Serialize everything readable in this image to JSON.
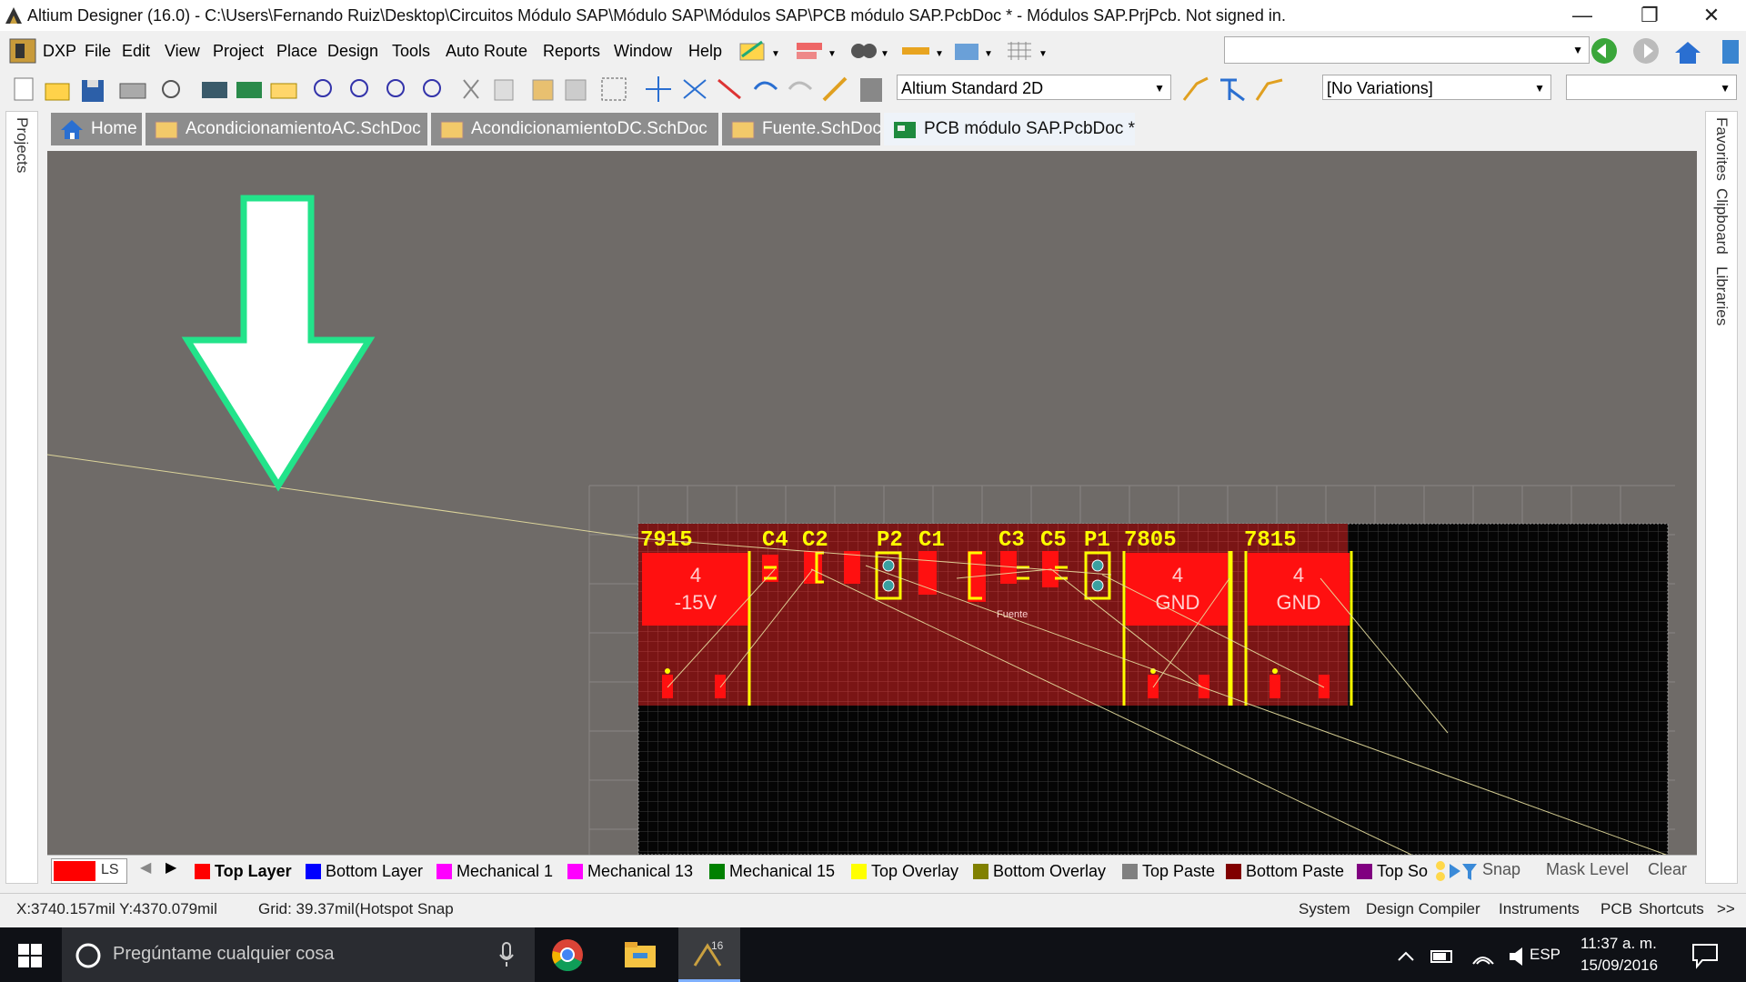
{
  "window": {
    "title": "Altium Designer (16.0) - C:\\Users\\Fernando Ruiz\\Desktop\\Circuitos Módulo SAP\\Módulo SAP\\Módulos SAP\\PCB módulo SAP.PcbDoc * - Módulos SAP.PrjPcb. Not signed in.",
    "minimize": "—",
    "restore": "❐",
    "close": "✕"
  },
  "menu": [
    "DXP",
    "File",
    "Edit",
    "View",
    "Project",
    "Place",
    "Design",
    "Tools",
    "Auto Route",
    "Reports",
    "Window",
    "Help"
  ],
  "toolbar": {
    "view_combo": "Altium Standard 2D",
    "variations_combo": "[No Variations]"
  },
  "tabs": [
    {
      "label": "Home",
      "active": false
    },
    {
      "label": "AcondicionamientoAC.SchDoc",
      "active": false
    },
    {
      "label": "AcondicionamientoDC.SchDoc",
      "active": false
    },
    {
      "label": "Fuente.SchDoc",
      "active": false
    },
    {
      "label": "PCB módulo SAP.PcbDoc *",
      "active": true
    }
  ],
  "left_panel": "Projects",
  "right_panels": [
    "Favorites",
    "Clipboard",
    "Libraries"
  ],
  "pcb": {
    "designators": [
      "7915",
      "C4",
      "C2",
      "P2",
      "C1",
      "C3",
      "C5",
      "P1",
      "7805",
      "7815"
    ],
    "pad_labels": [
      {
        "num": "4",
        "net": "-15V"
      },
      {
        "num": "4",
        "net": "GND"
      },
      {
        "num": "4",
        "net": "GND"
      }
    ],
    "sheet_label": "Fuente",
    "colors": {
      "board": "#7a1515",
      "overlay": "#ffff00",
      "pad": "#ff0000",
      "grid": "#2a2a2a"
    }
  },
  "layers": {
    "current": "LS",
    "items": [
      {
        "name": "Top Layer",
        "color": "#ff0000",
        "active": true
      },
      {
        "name": "Bottom Layer",
        "color": "#0000ff"
      },
      {
        "name": "Mechanical 1",
        "color": "#ff00ff"
      },
      {
        "name": "Mechanical 13",
        "color": "#ff00ff"
      },
      {
        "name": "Mechanical 15",
        "color": "#008000"
      },
      {
        "name": "Top Overlay",
        "color": "#ffff00"
      },
      {
        "name": "Bottom Overlay",
        "color": "#808000"
      },
      {
        "name": "Top Paste",
        "color": "#808080"
      },
      {
        "name": "Bottom Paste",
        "color": "#800000"
      },
      {
        "name": "Top So",
        "color": "#800080"
      }
    ],
    "snap": "Snap",
    "mask": "Mask Level",
    "clear": "Clear"
  },
  "status": {
    "coords": "X:3740.157mil Y:4370.079mil",
    "grid": "Grid: 39.37mil",
    "snap": "(Hotspot Snap",
    "buttons": [
      "System",
      "Design Compiler",
      "Instruments",
      "PCB",
      "Shortcuts",
      ">>"
    ]
  },
  "taskbar": {
    "search_placeholder": "Pregúntame cualquier cosa",
    "lang": "ESP",
    "time": "11:37 a. m.",
    "date": "15/09/2016"
  }
}
